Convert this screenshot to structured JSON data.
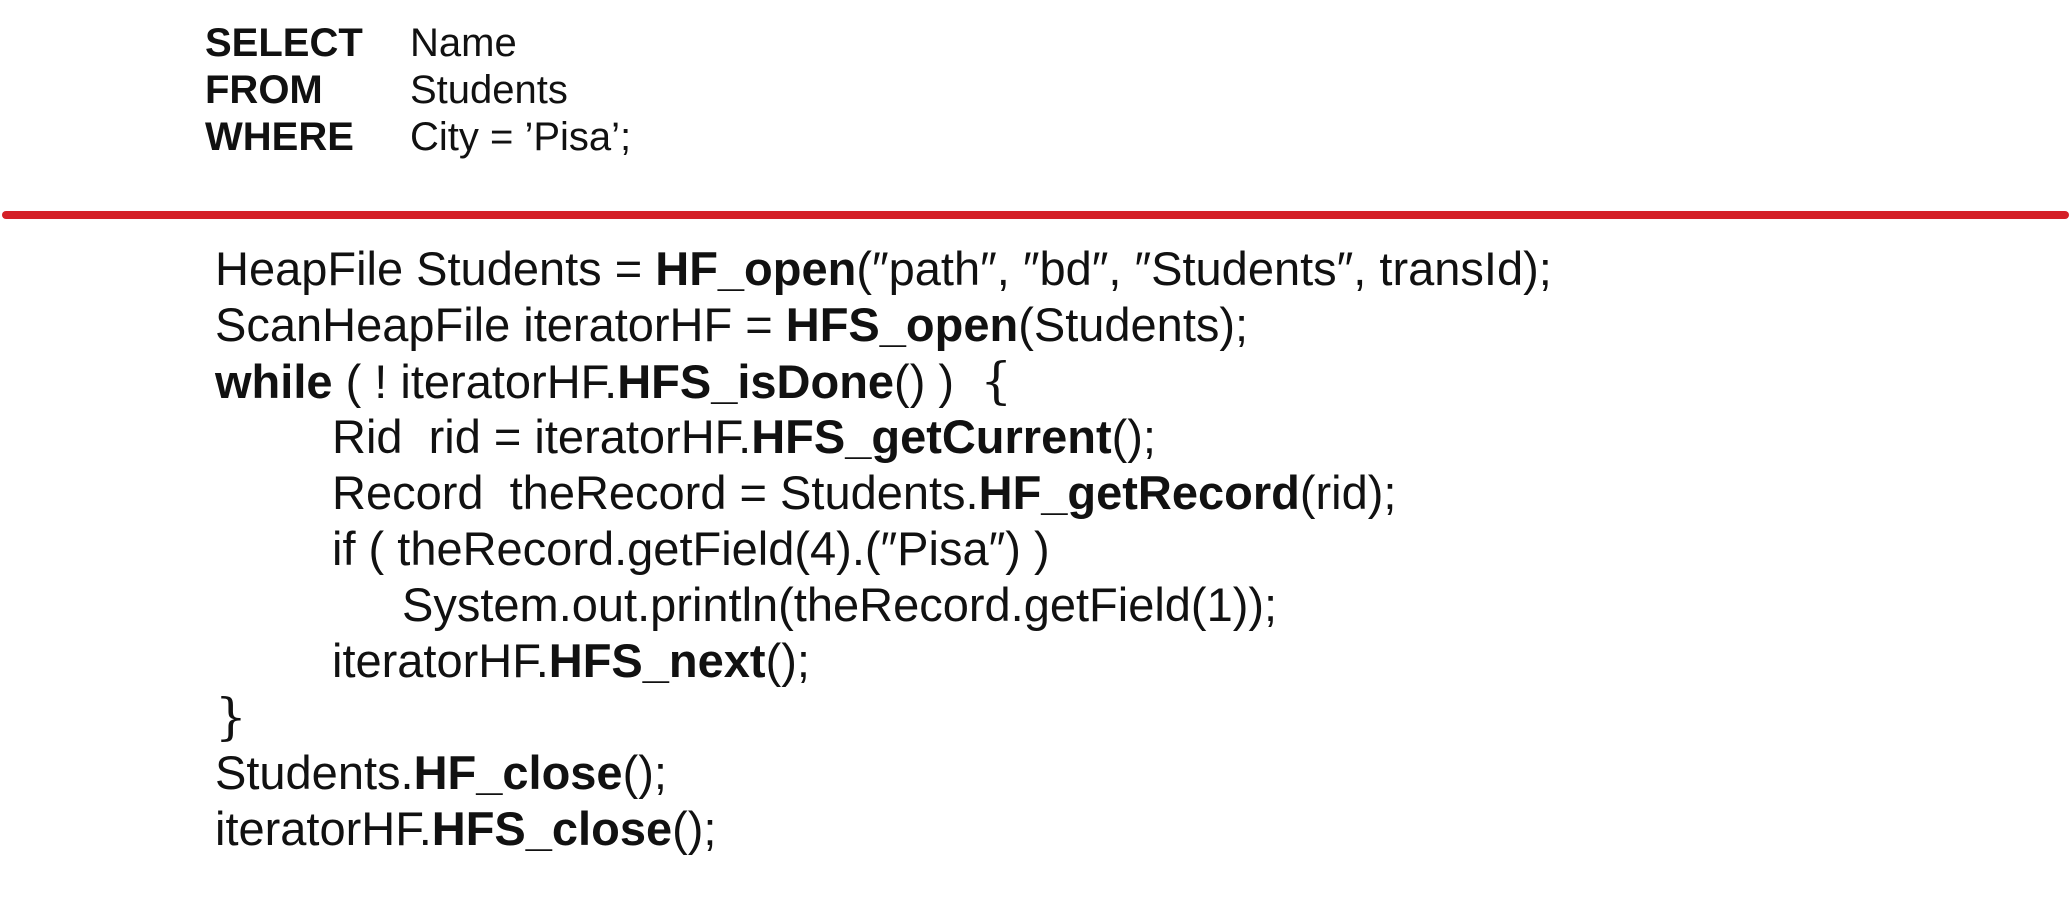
{
  "sql": {
    "select_kw": "SELECT",
    "select_val": "Name",
    "from_kw": "FROM",
    "from_val": "Students",
    "where_kw": "WHERE",
    "where_val": "City = ’Pisa’;"
  },
  "divider_color": "#d42027",
  "code": [
    {
      "segments": [
        {
          "t": "HeapFile Students = ",
          "b": false
        },
        {
          "t": "HF_open",
          "b": true
        },
        {
          "t": "(″path″, ″bd″, ″Students″, transId);",
          "b": false
        }
      ]
    },
    {
      "segments": [
        {
          "t": "ScanHeapFile iteratorHF = ",
          "b": false
        },
        {
          "t": "HFS_open",
          "b": true
        },
        {
          "t": "(Students);",
          "b": false
        }
      ]
    },
    {
      "segments": [
        {
          "t": "while",
          "b": true
        },
        {
          "t": " ( ! iteratorHF.",
          "b": false
        },
        {
          "t": "HFS_isDone",
          "b": true
        },
        {
          "t": "() )  ",
          "b": false
        },
        {
          "t": "{",
          "b": false,
          "brace": true
        }
      ]
    },
    {
      "segments": [
        {
          "t": "Rid  rid = iteratorHF.",
          "b": false
        },
        {
          "t": "HFS_getCurrent",
          "b": true
        },
        {
          "t": "();",
          "b": false
        }
      ]
    },
    {
      "segments": [
        {
          "t": "Record  theRecord = Students.",
          "b": false
        },
        {
          "t": "HF_getRecord",
          "b": true
        },
        {
          "t": "(rid);",
          "b": false
        }
      ]
    },
    {
      "segments": [
        {
          "t": "if ( theRecord.getField(4).(″Pisa″) )",
          "b": false
        }
      ]
    },
    {
      "segments": [
        {
          "t": "System.out.println(theRecord.getField(1));",
          "b": false
        }
      ]
    },
    {
      "segments": [
        {
          "t": "iteratorHF.",
          "b": false
        },
        {
          "t": "HFS_next",
          "b": true
        },
        {
          "t": "();",
          "b": false
        }
      ]
    },
    {
      "segments": [
        {
          "t": "}",
          "b": false,
          "brace": true
        }
      ]
    },
    {
      "segments": [
        {
          "t": "Students.",
          "b": false
        },
        {
          "t": "HF_close",
          "b": true
        },
        {
          "t": "();",
          "b": false
        }
      ]
    },
    {
      "segments": [
        {
          "t": "iteratorHF.",
          "b": false
        },
        {
          "t": "HFS_close",
          "b": true
        },
        {
          "t": "();",
          "b": false
        }
      ]
    }
  ]
}
